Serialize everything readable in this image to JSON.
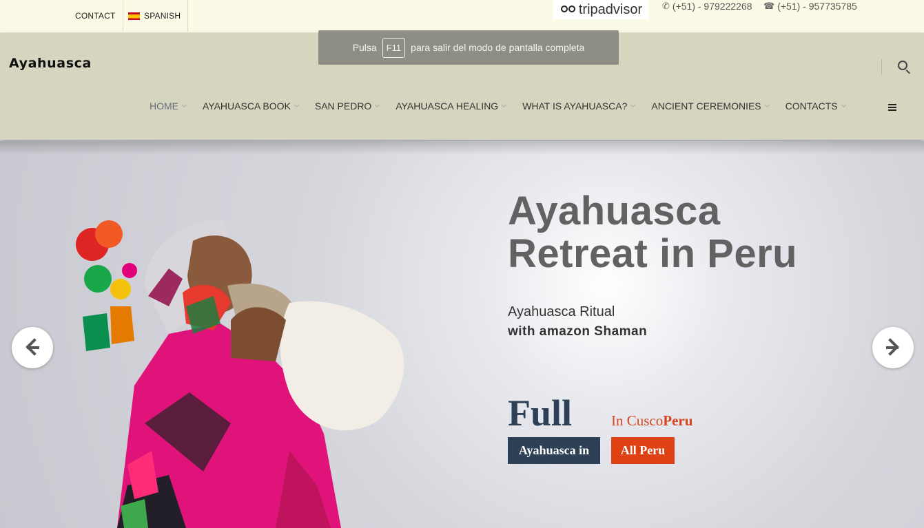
{
  "topbar": {
    "contact": "CONTACT",
    "spanish": "SPANISH",
    "tripadvisor": "tripadvisor",
    "phone1": "(+51) - 979222268",
    "phone2": "(+51) - 957735785"
  },
  "header": {
    "logo": "Ayahuasca",
    "nav": [
      "HOME",
      "AYAHUASCA BOOK",
      "SAN PEDRO",
      "AYAHUASCA HEALING",
      "WHAT IS AYAHUASCA?",
      "ANCIENT CEREMONIES",
      "CONTACTS"
    ]
  },
  "fullscreen_notice": {
    "before": "Pulsa",
    "key": "F11",
    "after": "para salir del modo de pantalla completa"
  },
  "hero": {
    "headline": "Ayahuasca Retreat in Peru",
    "sub1": "Ayahuasca Ritual",
    "sub2": "with amazon Shaman",
    "full": "Full",
    "in_cusco": "In Cusco",
    "peru": "Peru",
    "tag_dark": "Ayahuasca in",
    "tag_red": "All Peru"
  },
  "colors": {
    "topbar_bg": "#fafae6",
    "header_bg": "#d6d5bf",
    "navy": "#2e4055",
    "accent_red": "#df4115"
  },
  "icons": [
    "whatsapp-icon",
    "phone-icon",
    "search-icon",
    "hamburger-icon",
    "arrow-left-icon",
    "arrow-right-icon",
    "spain-flag-icon",
    "tripadvisor-owl-icon"
  ]
}
